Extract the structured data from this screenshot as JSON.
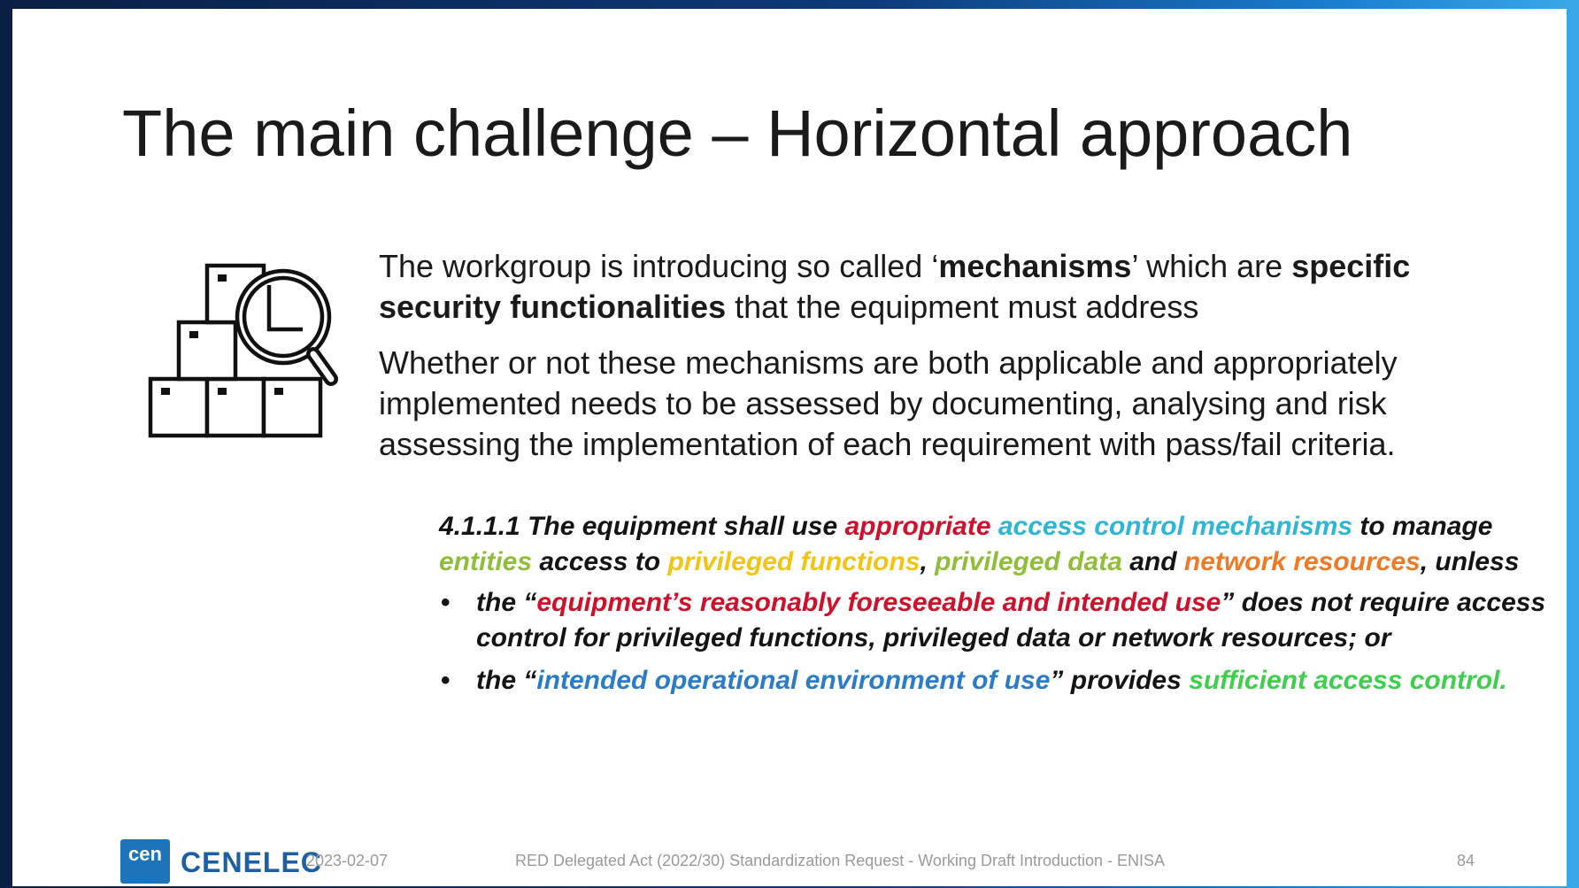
{
  "slide": {
    "title": "The main challenge – Horizontal approach",
    "icon": "boxes-magnifier-clock-icon",
    "paragraph1": {
      "t1": "The workgroup is introducing so called ‘",
      "b1": "mechanisms",
      "t2": "’ which are ",
      "b2": "specific security functionalities",
      "t3": " that the equipment must address"
    },
    "paragraph2": "Whether or not these mechanisms are both applicable and appropriately implemented needs to be assessed by documenting, analysing and risk assessing the implementation of each requirement with pass/fail criteria.",
    "requirement": {
      "s1": "4.1.1.1 The equipment shall use ",
      "s2": "appropriate",
      "s3": " ",
      "s4": "access control mechanisms",
      "s5": " to manage ",
      "s6": "entities",
      "s7": " access to ",
      "s8": "privileged functions",
      "s9": ", ",
      "s10": "privileged data",
      "s11": " and ",
      "s12": "network resources",
      "s13": ", unless",
      "bullet1": {
        "a": "the “",
        "b": "equipment’s reasonably foreseeable and intended use",
        "c": "” does not require access control for privileged functions, privileged data or network resources; or"
      },
      "bullet2": {
        "a": "the “",
        "b": "intended operational environment of use",
        "c": "” provides ",
        "d": "sufficient access control."
      }
    },
    "colors": {
      "red": "#d0102a",
      "cyan": "#2eb6d8",
      "green": "#8fbf3a",
      "yellow": "#f2c514",
      "orange": "#ef7a26",
      "blue": "#2a7cc9",
      "light_green": "#3fce4e"
    }
  },
  "footer": {
    "logo_box_text": "cen",
    "logo_text": "CENELEC",
    "date": "2023-02-07",
    "caption": "RED Delegated Act (2022/30) Standardization Request - Working Draft Introduction - ENISA",
    "page_number": "84"
  }
}
